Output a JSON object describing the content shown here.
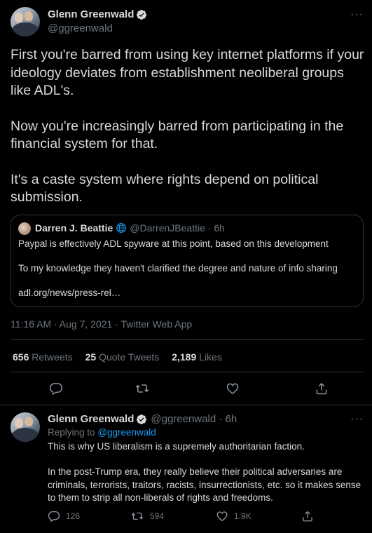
{
  "main_tweet": {
    "name": "Glenn Greenwald",
    "handle": "@ggreenwald",
    "paragraphs": [
      "First you're barred from using key internet platforms if your ideology deviates from establishment neoliberal groups like ADL's.",
      "Now you're increasingly barred from participating in the financial system for that.",
      "It's a caste system where rights depend on political submission."
    ],
    "quote": {
      "name": "Darren J. Beattie",
      "handle": "@DarrenJBeattie · 6h",
      "line1": "Paypal is effectively ADL spyware at this point, based on this development",
      "line2": "To my knowledge they haven't clarified the degree and nature of info sharing",
      "line3": "adl.org/news/press-rel…"
    },
    "meta": "11:16 AM · Aug 7, 2021 · Twitter Web App",
    "stats": {
      "retweets_count": "656",
      "retweets_label": "Retweets",
      "quotes_count": "25",
      "quotes_label": "Quote Tweets",
      "likes_count": "2,189",
      "likes_label": "Likes"
    },
    "more": "···"
  },
  "reply_tweet": {
    "name": "Glenn Greenwald",
    "handle": "@ggreenwald · 6h",
    "replying_prefix": "Replying to",
    "replying_handle": "@ggreenwald",
    "line1": "This is why US liberalism is a supremely authoritarian faction.",
    "para2_line1": "In the post-Trump era, they really believe their political adversaries are",
    "para2_line2": "criminals, terrorists, traitors, racists, insurrectionists, etc. so it makes sense",
    "para2_line3": "to them to strip all non-liberals of rights and freedoms.",
    "reply_count": "126",
    "retweet_count": "594",
    "like_count": "1.9K",
    "more": "···"
  },
  "colors": {
    "background": "#000000",
    "text": "#d9d9d9",
    "muted": "#6e767d",
    "accent": "#1d9bf0",
    "border": "#2f3336"
  },
  "icons": [
    "verified-badge-icon",
    "globe-icon",
    "reply-icon",
    "retweet-icon",
    "like-icon",
    "share-icon",
    "more-icon"
  ]
}
